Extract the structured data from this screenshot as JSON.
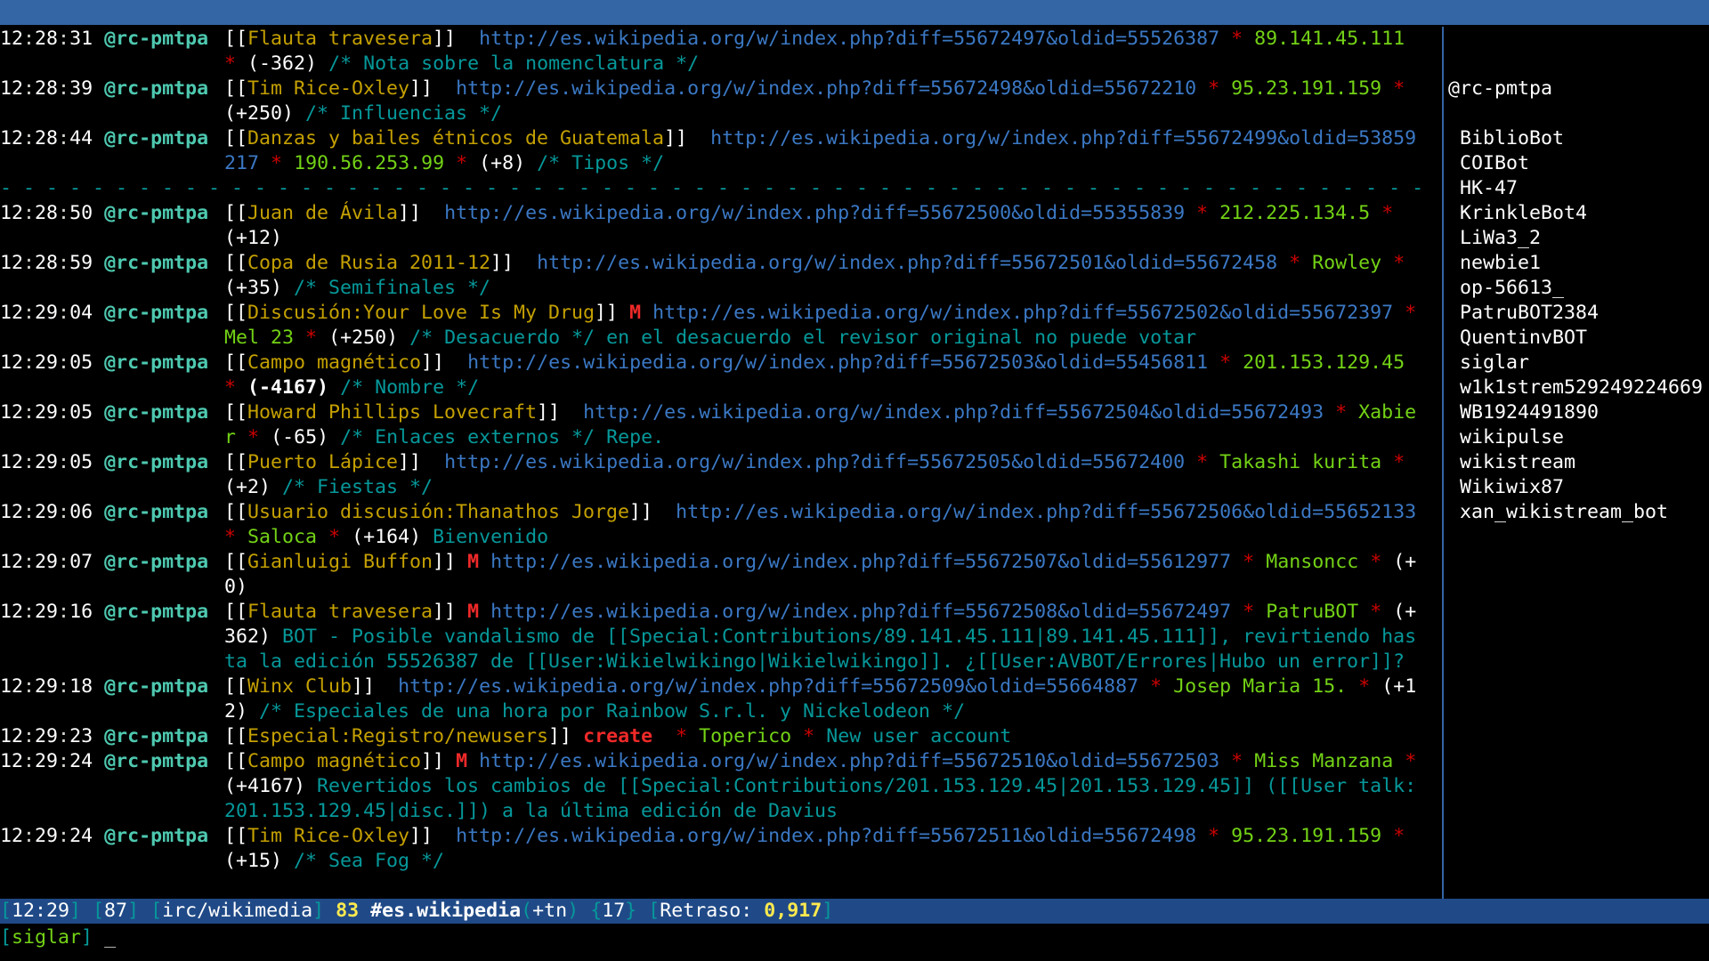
{
  "colors": {
    "title_bar": "#3465a4",
    "status_bar": "#204a87",
    "nick": "#4ec9b0",
    "url": "#3b78c4",
    "article": "#c4a000",
    "user": "#73d216",
    "star": "#cc0000"
  },
  "channel_nick": "@rc-pmtpa",
  "separator": "|",
  "marker_line": "- - - - - - - - - - - - - - - - - - - - - - - - - - - - - - - - - - - - - - - - - - - - - - - - - - - - - - - - - - - - - - - - - - - - - - - - - - - - - - - - - - - - - - - - - - - - - - - - - - - - - -",
  "messages": [
    {
      "hh": "12",
      "mm": "28",
      "ss": "31",
      "title": "Flauta travesera",
      "flag": "",
      "url": "http://es.wikipedia.org/w/index.php?diff=55672497&oldid=55526387",
      "user": "89.141.45.111",
      "size": "(-362)",
      "comment": "/* Nota sobre la nomenclatura */",
      "summary": ""
    },
    {
      "hh": "12",
      "mm": "28",
      "ss": "39",
      "title": "Tim Rice-Oxley",
      "flag": "",
      "url": "http://es.wikipedia.org/w/index.php?diff=55672498&oldid=55672210",
      "user": "95.23.191.159",
      "size": "(+250)",
      "comment": "/* Influencias */",
      "summary": ""
    },
    {
      "hh": "12",
      "mm": "28",
      "ss": "44",
      "title": "Danzas y bailes étnicos de Guatemala",
      "flag": "",
      "url": "http://es.wikipedia.org/w/index.php?diff=55672499&oldid=53859217",
      "user": "190.56.253.99",
      "size": "(+8)",
      "comment": "/* Tipos */",
      "summary": ""
    },
    {
      "hh": "12",
      "mm": "28",
      "ss": "50",
      "title": "Juan de Ávila",
      "flag": "",
      "url": "http://es.wikipedia.org/w/index.php?diff=55672500&oldid=55355839",
      "user": "212.225.134.5",
      "size": "(+12)",
      "comment": "",
      "summary": ""
    },
    {
      "hh": "12",
      "mm": "28",
      "ss": "59",
      "title": "Copa de Rusia 2011-12",
      "flag": "",
      "url": "http://es.wikipedia.org/w/index.php?diff=55672501&oldid=55672458",
      "user": "Rowley",
      "size": "(+35)",
      "comment": "/* Semifinales */",
      "summary": ""
    },
    {
      "hh": "12",
      "mm": "29",
      "ss": "04",
      "title": "Discusión:Your Love Is My Drug",
      "flag": "M",
      "url": "http://es.wikipedia.org/w/index.php?diff=55672502&oldid=55672397",
      "user": "Mel 23",
      "size": "(+250)",
      "comment": "/* Desacuerdo */",
      "summary": "en el desacuerdo el revisor original no puede votar"
    },
    {
      "hh": "12",
      "mm": "29",
      "ss": "05",
      "title": "Campo magnético",
      "flag": "",
      "url": "http://es.wikipedia.org/w/index.php?diff=55672503&oldid=55456811",
      "user": "201.153.129.45",
      "size": "(-4167)",
      "comment": "/* Nombre */",
      "summary": "",
      "big": true
    },
    {
      "hh": "12",
      "mm": "29",
      "ss": "05",
      "title": "Howard Phillips Lovecraft",
      "flag": "",
      "url": "http://es.wikipedia.org/w/index.php?diff=55672504&oldid=55672493",
      "user": "Xabier",
      "size": "(-65)",
      "comment": "/* Enlaces externos */",
      "summary": "Repe."
    },
    {
      "hh": "12",
      "mm": "29",
      "ss": "05",
      "title": "Puerto Lápice",
      "flag": "",
      "url": "http://es.wikipedia.org/w/index.php?diff=55672505&oldid=55672400",
      "user": "Takashi kurita",
      "size": "(+2)",
      "comment": "/* Fiestas */",
      "summary": ""
    },
    {
      "hh": "12",
      "mm": "29",
      "ss": "06",
      "title": "Usuario discusión:Thanathos Jorge",
      "flag": "",
      "url": "http://es.wikipedia.org/w/index.php?diff=55672506&oldid=55652133",
      "user": "Saloca",
      "size": "(+164)",
      "comment": "",
      "summary": "Bienvenido"
    },
    {
      "hh": "12",
      "mm": "29",
      "ss": "07",
      "title": "Gianluigi Buffon",
      "flag": "M",
      "url": "http://es.wikipedia.org/w/index.php?diff=55672507&oldid=55612977",
      "user": "Mansoncc",
      "size": "(+0)",
      "comment": "",
      "summary": ""
    },
    {
      "hh": "12",
      "mm": "29",
      "ss": "16",
      "title": "Flauta travesera",
      "flag": "M",
      "url": "http://es.wikipedia.org/w/index.php?diff=55672508&oldid=55672497",
      "user": "PatruBOT",
      "size": "(+362)",
      "comment": "",
      "summary": "BOT - Posible vandalismo de [[Special:Contributions/89.141.45.111|89.141.45.111]], revirtiendo hasta la edición 55526387 de [[User:Wikielwikingo|Wikielwikingo]]. ¿[[User:AVBOT/Errores|Hubo un error]]?"
    },
    {
      "hh": "12",
      "mm": "29",
      "ss": "18",
      "title": "Winx Club",
      "flag": "",
      "url": "http://es.wikipedia.org/w/index.php?diff=55672509&oldid=55664887",
      "user": "Josep Maria 15.",
      "size": "(+12)",
      "comment": "/* Especiales de una hora por Rainbow S.r.l. y Nickelodeon */",
      "summary": ""
    },
    {
      "hh": "12",
      "mm": "29",
      "ss": "23",
      "title": "Especial:Registro/newusers",
      "flag": "",
      "action": "create",
      "url": "",
      "user": "Toperico",
      "size": "",
      "comment": "",
      "summary": "New user account"
    },
    {
      "hh": "12",
      "mm": "29",
      "ss": "24",
      "title": "Campo magnético",
      "flag": "M",
      "url": "http://es.wikipedia.org/w/index.php?diff=55672510&oldid=55672503",
      "user": "Miss Manzana",
      "size": "(+4167)",
      "comment": "",
      "summary": "Revertidos los cambios de [[Special:Contributions/201.153.129.45|201.153.129.45]] ([[User talk:201.153.129.45|disc.]]) a la última edición de Davius"
    },
    {
      "hh": "12",
      "mm": "29",
      "ss": "24",
      "title": "Tim Rice-Oxley",
      "flag": "",
      "url": "http://es.wikipedia.org/w/index.php?diff=55672511&oldid=55672498",
      "user": "95.23.191.159",
      "size": "(+15)",
      "comment": "/* Sea Fog */",
      "summary": ""
    }
  ],
  "nicklist": {
    "op": "@rc-pmtpa",
    "users": [
      "BiblioBot",
      "COIBot",
      "HK-47",
      "KrinkleBot4",
      "LiWa3_2",
      "newbie1",
      "op-56613_",
      "PatruBOT2384",
      "QuentinvBOT",
      "siglar",
      "w1k1strem529249224669",
      "WB1924491890",
      "wikipulse",
      "wikistream",
      "Wikiwix87",
      "xan_wikistream_bot"
    ]
  },
  "status": {
    "time": "12:29",
    "window_number": "87",
    "server": "irc/wikimedia",
    "channel_number": "83",
    "channel": "#es.wikipedia",
    "modes": "+tn",
    "nick_count": "17",
    "lag_label": "Retraso:",
    "lag_value": "0,917"
  },
  "input": {
    "nick": "siglar",
    "value": "",
    "cursor": "_"
  }
}
